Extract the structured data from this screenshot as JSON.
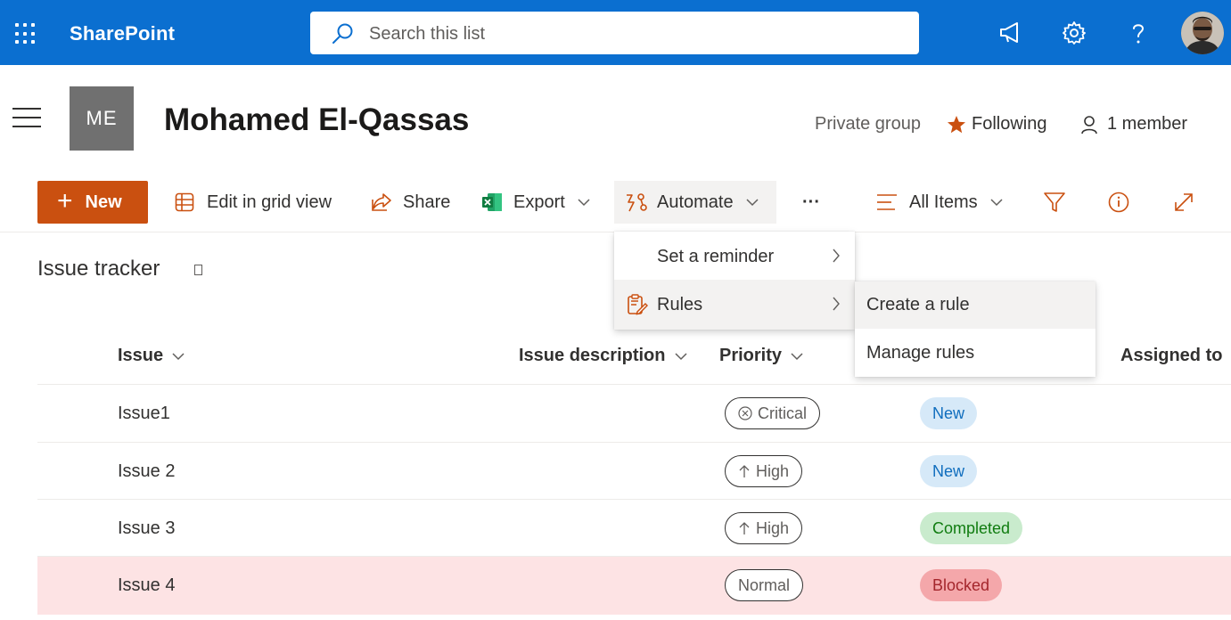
{
  "suite": {
    "app_name": "SharePoint",
    "search_placeholder": "Search this list"
  },
  "site": {
    "logo_initials": "ME",
    "title": "Mohamed El-Qassas",
    "privacy": "Private group",
    "following": "Following",
    "members": "1 member"
  },
  "commandbar": {
    "new": "New",
    "edit_grid": "Edit in grid view",
    "share": "Share",
    "export": "Export",
    "automate": "Automate",
    "more": "···",
    "view": "All Items"
  },
  "automate_menu": {
    "items": [
      {
        "label": "Set a reminder"
      },
      {
        "label": "Rules"
      }
    ]
  },
  "rules_submenu": {
    "items": [
      {
        "label": "Create a rule"
      },
      {
        "label": "Manage rules"
      }
    ]
  },
  "list": {
    "title": "Issue tracker",
    "columns": {
      "issue": "Issue",
      "description": "Issue description",
      "priority": "Priority",
      "assigned": "Assigned to"
    },
    "rows": [
      {
        "issue": "Issue1",
        "priority": "Critical",
        "status": "New"
      },
      {
        "issue": "Issue 2",
        "priority": "High",
        "status": "New"
      },
      {
        "issue": "Issue 3",
        "priority": "High",
        "status": "Completed"
      },
      {
        "issue": "Issue 4",
        "priority": "Normal",
        "status": "Blocked"
      }
    ]
  },
  "colors": {
    "suite_bar": "#0b6fd0",
    "accent_orange": "#ca5010",
    "blocked_row": "#fde3e4"
  }
}
